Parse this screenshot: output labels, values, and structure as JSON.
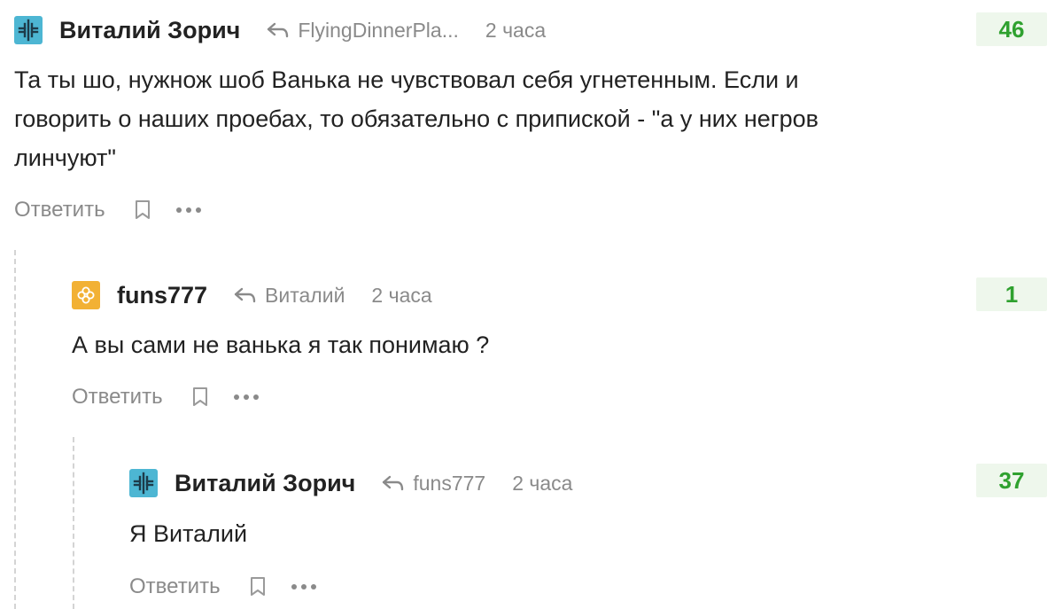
{
  "colors": {
    "rating_bg": "#eef7ec",
    "rating_text": "#2fa12f",
    "avatar_zorich": "#4db6d3",
    "avatar_funs": "#f2b134",
    "muted_text": "#8a8a8a"
  },
  "comments": [
    {
      "author": "Виталий Зорич",
      "reply_to": "FlyingDinnerPla...",
      "time": "2 часа",
      "rating": "46",
      "lines": [
        "Та ты шо, нужнож шоб Ванька не чувствовал себя угнетенным. Если и",
        "говорить о наших проебах, то обязательно с припиской - \"а у них негров",
        "линчуют\""
      ],
      "reply_label": "Ответить",
      "avatar_icon": "cross-logo-icon"
    },
    {
      "author": "funs777",
      "reply_to": "Виталий",
      "time": "2 часа",
      "rating": "1",
      "lines": [
        "А вы сами не ванька я так понимаю ?"
      ],
      "reply_label": "Ответить",
      "avatar_icon": "clover-icon"
    },
    {
      "author": "Виталий Зорич",
      "reply_to": "funs777",
      "time": "2 часа",
      "rating": "37",
      "lines": [
        "Я Виталий"
      ],
      "reply_label": "Ответить",
      "avatar_icon": "cross-logo-icon"
    }
  ]
}
